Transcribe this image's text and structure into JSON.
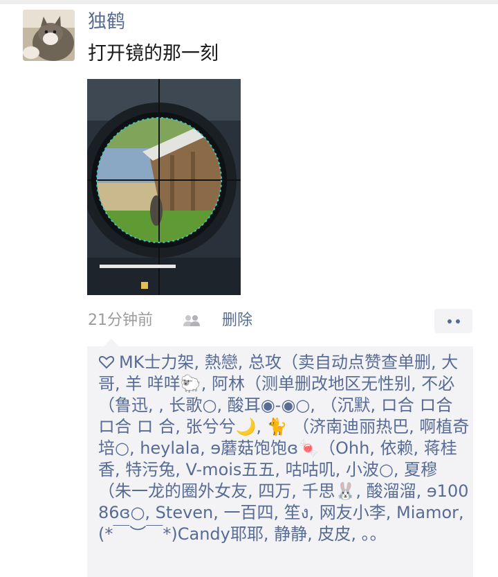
{
  "post": {
    "username": "独鹤",
    "text": "打开镜的那一刻",
    "time": "21分钟前",
    "delete_label": "删除",
    "likes": "MK士力架, 熱戀, 总攻（卖自动点赞查单删, 大哥, 羊 咩咩🐑, 阿林（测单删改地区无性别, 不必（鲁迅, , 长歌○, 酸耳◉-◉○, （沉默, ロ合 ロ合 ロ合 ロ 合, 张兮兮🌙, 🐈 （济南迪丽热巴, 啊植奇培○, heylala, ɘ蘑菇饱饱ɞ🍬（Ohh, 依赖, 蒋桂香, 特污兔, V-mois五五, 咕咕叽, 小波○, 夏穆（朱一龙的圈外女友, 四万, 千思🐰, 酸溜溜, ɘ10086ɞ○, Steven, 一百四, 笙ง, 网友小李, Miamor, (*￣︶￣*)Candy耶耶, 静静, 皮皮, 。。"
  },
  "icons": {
    "avatar": "cat-avatar",
    "privacy": "people-icon",
    "more": "more-dots-icon",
    "like": "heart-outline-icon"
  },
  "colors": {
    "link": "#576b95",
    "panel": "#f3f3f5",
    "muted": "#9b9b9b"
  }
}
